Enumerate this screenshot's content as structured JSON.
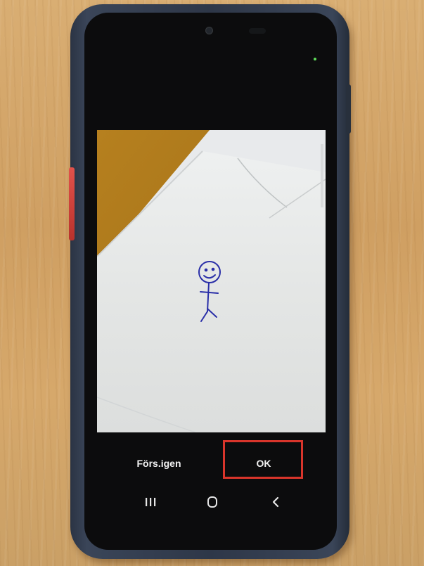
{
  "camera_review": {
    "retry_label": "Förs.igen",
    "ok_label": "OK"
  },
  "navigation": {
    "recent_icon": "recent-apps-icon",
    "home_icon": "home-icon",
    "back_icon": "back-chevron-icon"
  },
  "colors": {
    "highlight": "#d9352b",
    "phone_case": "#2e3748",
    "drawing_ink": "#2a2fa8"
  }
}
